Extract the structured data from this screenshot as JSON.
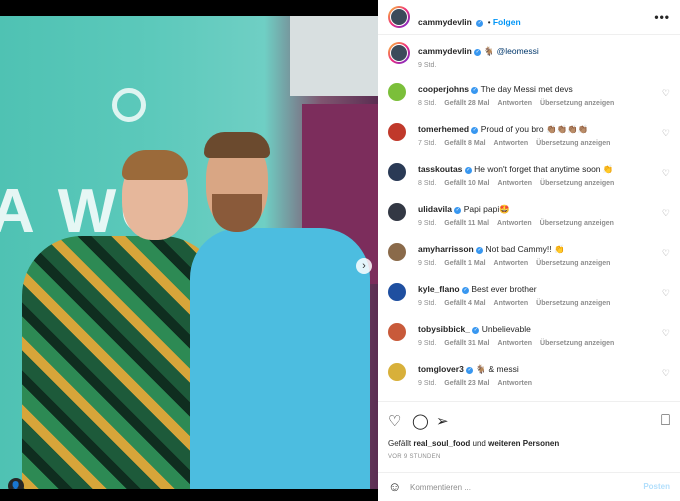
{
  "post": {
    "author": "cammydevlin",
    "follow_label": "Folgen",
    "more_label": "•••",
    "caption_emoji": "🐐",
    "caption_mention": "@leomessi",
    "caption_time": "9 Std."
  },
  "media": {
    "wall_text": "A WO",
    "next_arrow": "›",
    "dots": "•••",
    "tag_icon": "👤"
  },
  "comments": [
    {
      "user": "cooperjohns",
      "text": "The day Messi met devs",
      "time": "8 Std.",
      "likes": "Gefällt 28 Mal",
      "reply": "Antworten",
      "translate": "Übersetzung anzeigen",
      "avatar_color": "#7bbf3a"
    },
    {
      "user": "tomerhemed",
      "text": "Proud of you bro 👏🏽👏🏽👏🏽👏🏽",
      "time": "7 Std.",
      "likes": "Gefällt 8 Mal",
      "reply": "Antworten",
      "translate": "Übersetzung anzeigen",
      "avatar_color": "#c0392b"
    },
    {
      "user": "tasskoutas",
      "text": "He won't forget that anytime soon 👏",
      "time": "8 Std.",
      "likes": "Gefällt 10 Mal",
      "reply": "Antworten",
      "translate": "Übersetzung anzeigen",
      "avatar_color": "#2a3a55"
    },
    {
      "user": "ulidavila",
      "text": "Papi papi🤩",
      "time": "9 Std.",
      "likes": "Gefällt 11 Mal",
      "reply": "Antworten",
      "translate": "Übersetzung anzeigen",
      "avatar_color": "#333844"
    },
    {
      "user": "amyharrisson",
      "text": "Not bad Cammy!! 👏",
      "time": "9 Std.",
      "likes": "Gefällt 1 Mal",
      "reply": "Antworten",
      "translate": "Übersetzung anzeigen",
      "avatar_color": "#8a6a4a"
    },
    {
      "user": "kyle_flano",
      "text": "Best ever brother",
      "time": "9 Std.",
      "likes": "Gefällt 4 Mal",
      "reply": "Antworten",
      "translate": "Übersetzung anzeigen",
      "avatar_color": "#1f4fa0"
    },
    {
      "user": "tobysibbick_",
      "text": "Unbelievable",
      "time": "9 Std.",
      "likes": "Gefällt 31 Mal",
      "reply": "Antworten",
      "translate": "Übersetzung anzeigen",
      "avatar_color": "#c85a3a"
    },
    {
      "user": "tomglover3",
      "text": "🐐 & messi",
      "time": "9 Std.",
      "likes": "Gefällt 23 Mal",
      "reply": "Antworten",
      "translate": "",
      "avatar_color": "#d8b03a"
    }
  ],
  "actions": {
    "like_icon": "♡",
    "comment_icon": "◯",
    "share_icon": "➢",
    "save_icon": "⎕",
    "likes_prefix": "Gefällt",
    "likes_user": "real_soul_food",
    "likes_and": "und",
    "likes_others": "weiteren Personen",
    "ago": "VOR 9 STUNDEN"
  },
  "composer": {
    "emoji_icon": "☺",
    "placeholder": "Kommentieren ...",
    "post_label": "Posten"
  },
  "colors": {
    "accent": "#0095f6",
    "verified": "#3897f0",
    "muted": "#8e8e8e"
  }
}
